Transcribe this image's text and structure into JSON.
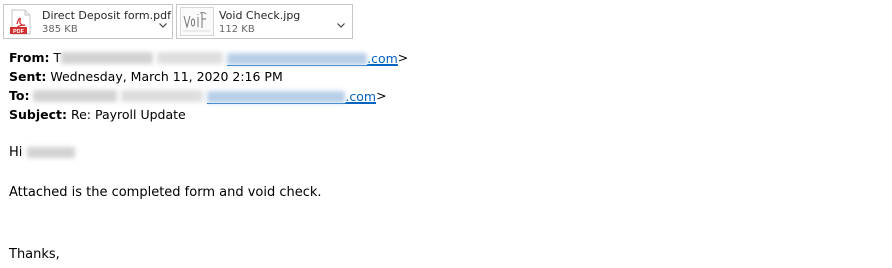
{
  "attachments": [
    {
      "name": "Direct Deposit form.pdf",
      "size": "385 KB",
      "icon": "pdf-file-icon",
      "thumb_label": "PDF"
    },
    {
      "name": "Void Check.jpg",
      "size": "112 KB",
      "icon": "image-thumbnail-icon"
    }
  ],
  "headers": {
    "from_label": "From:",
    "from_visible_prefix": "T",
    "from_email_suffix": ".com",
    "from_close": ">",
    "sent_label": "Sent:",
    "sent_value": "Wednesday, March 11, 2020 2:16 PM",
    "to_label": "To:",
    "to_email_suffix": ".com",
    "to_close": ">",
    "subject_label": "Subject:",
    "subject_value": "Re: Payroll Update"
  },
  "body": {
    "greeting": "Hi",
    "line1": "Attached is the completed form and void check.",
    "signoff": "Thanks,"
  },
  "colors": {
    "link": "#0563c1",
    "pdf_red": "#d32f2f"
  }
}
